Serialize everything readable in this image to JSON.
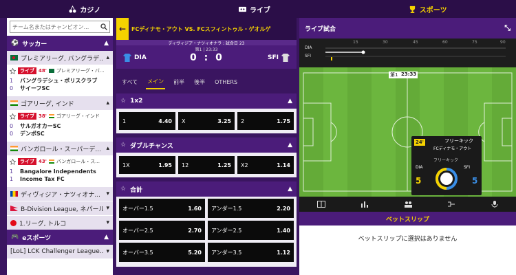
{
  "nav": {
    "casino": "カジノ",
    "live": "ライブ",
    "sports": "スポーツ"
  },
  "search": {
    "placeholder": "チーム名またはチャンピオン..."
  },
  "sidebar": {
    "soccer": "サッカー",
    "leagues": [
      {
        "name": "プレミアリーグ, バングラデ...",
        "event": {
          "live": "ライブ",
          "minute": "48'",
          "league": "プレミアリーグ・バ...",
          "score1": "1",
          "score2": "0",
          "team1": "バングラデシュ・ポリスクラブ",
          "team2": "サイーフSC"
        }
      },
      {
        "name": "ゴアリーグ, インド",
        "event": {
          "live": "ライブ",
          "minute": "38'",
          "league": "ゴアリーグ・インド",
          "score1": "0",
          "score2": "0",
          "team1": "サルガオカーSC",
          "team2": "デンポSC"
        }
      },
      {
        "name": "バンガロール・スーパーデ...",
        "event": {
          "live": "ライブ",
          "minute": "43'",
          "league": "バンガロール・ス...",
          "score1": "1",
          "score2": "1",
          "team1": "Bangalore Independents",
          "team2": "Income Tax FC"
        }
      }
    ],
    "more_leagues": [
      "ディヴィジア・ナツィオナ...",
      "B-Division League, ネパール",
      "1.リーグ, トルコ"
    ],
    "esports": "eスポーツ",
    "esports_league": "[LoL] LCK Challenger League..."
  },
  "match": {
    "title": "FCディナモ・アウト VS. FCスフィントゥル・ゲオルゲ",
    "league": "ディヴィジア・ナツィオナラ : 試合日 23",
    "period": "第1 | 23:33",
    "home": "DIA",
    "away": "SFI",
    "score": "0 : 0",
    "tabs": [
      "すべて",
      "メイン",
      "前半",
      "後半",
      "OTHERS"
    ],
    "markets": [
      {
        "name": "1x2",
        "odds": [
          [
            "1",
            "4.40"
          ],
          [
            "X",
            "3.25"
          ],
          [
            "2",
            "1.75"
          ]
        ]
      },
      {
        "name": "ダブルチャンス",
        "odds": [
          [
            "1X",
            "1.95"
          ],
          [
            "12",
            "1.25"
          ],
          [
            "X2",
            "1.14"
          ]
        ]
      },
      {
        "name": "合計",
        "rows": [
          [
            [
              "オーバー1.5",
              "1.60"
            ],
            [
              "アンダー1.5",
              "2.20"
            ]
          ],
          [
            [
              "オーバー2.5",
              "2.70"
            ],
            [
              "アンダー2.5",
              "1.40"
            ]
          ],
          [
            [
              "オーバー3.5",
              "5.20"
            ],
            [
              "アンダー3.5",
              "1.12"
            ]
          ]
        ]
      }
    ]
  },
  "live": {
    "title": "ライブ試合",
    "timeline_ticks": [
      "15",
      "30",
      "45",
      "60",
      "75",
      "90"
    ],
    "home": "DIA",
    "away": "SFI",
    "clock": "第1",
    "time": "23:33",
    "popup": {
      "minute": "24'",
      "event": "フリーキック",
      "team": "FCディナモ・アウト",
      "label": "フリーキック",
      "home": "DIA",
      "away": "SFI",
      "home_val": "5",
      "away_val": "5"
    }
  },
  "betslip": {
    "title": "ベットスリップ",
    "empty": "ベットスリップに選択はありません"
  },
  "colors": {
    "accent": "#f5d200",
    "purple": "#4b1c7a",
    "live": "#d5102c"
  }
}
